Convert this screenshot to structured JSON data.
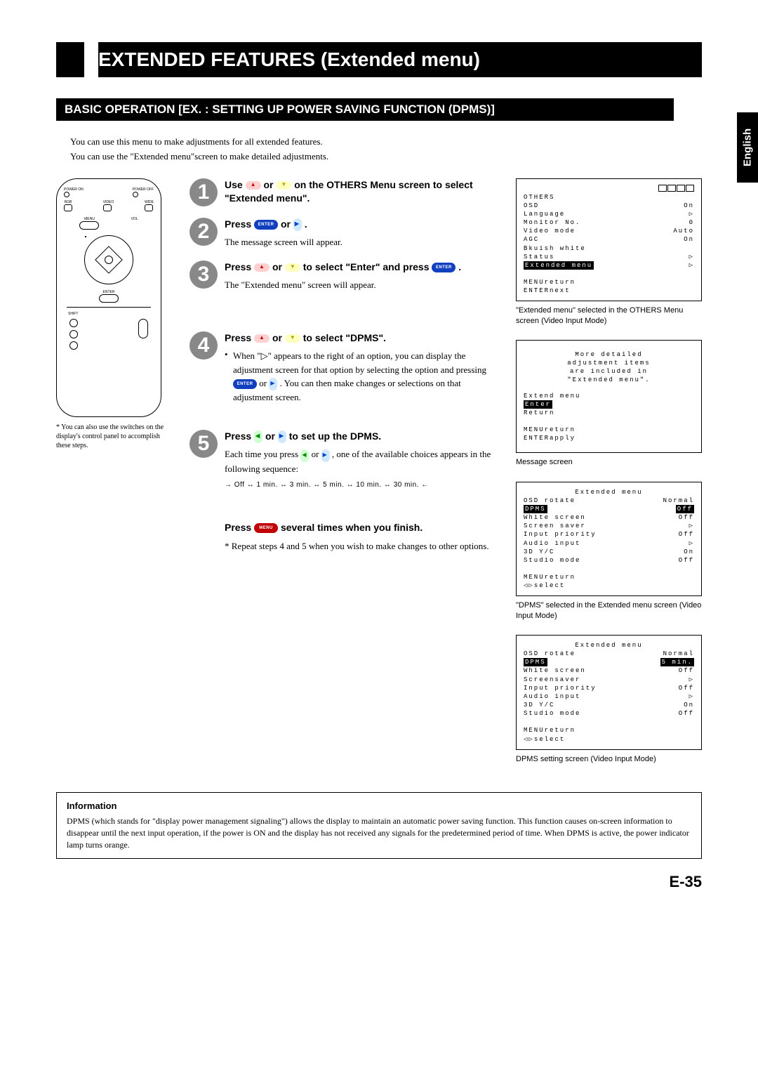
{
  "title": "EXTENDED FEATURES (Extended menu)",
  "subtitle": "BASIC OPERATION [EX. : SETTING UP POWER SAVING FUNCTION (DPMS)]",
  "side_tab": "English",
  "intro_line1": "You can use this menu to make adjustments for all extended features.",
  "intro_line2": "You can use the \"Extended menu\"screen to make detailed adjustments.",
  "remote": {
    "power_on": "POWER ON",
    "power_off": "POWER OFF",
    "rgb": "RGB",
    "video": "VIDEO",
    "wide": "WIDE",
    "menu": "MENU",
    "vol": "VOL",
    "enter": "ENTER",
    "shift": "SHIFT",
    "note": "* You can also use the switches on the display's control panel to accomplish these steps."
  },
  "steps": {
    "s1": {
      "num": "1",
      "t1": "Use ",
      "t2": " or ",
      "t3": " on the OTHERS Menu screen to select \"Extended menu\"."
    },
    "s2": {
      "num": "2",
      "t1": "Press ",
      "t2": " or ",
      "t3": ".",
      "note": "The message screen will appear."
    },
    "s3": {
      "num": "3",
      "t1": "Press ",
      "t2": " or ",
      "t3": " to select \"Enter\" and press ",
      "t4": ".",
      "note": "The \"Extended menu\" screen will appear."
    },
    "s4": {
      "num": "4",
      "t1": "Press ",
      "t2": " or ",
      "t3": " to select \"DPMS\".",
      "b1": "When \"▷\" appears to the right of an option, you can display the adjustment screen for that option by selecting the option and pressing ",
      "b2": " or ",
      "b3": ". You can then make changes or selections on that adjustment screen."
    },
    "s5": {
      "num": "5",
      "t1": "Press ",
      "t2": " or ",
      "t3": " to set up the DPMS.",
      "note1": "Each time you press ",
      "note2": " or ",
      "note3": ", one of the available choices appears in the following sequence:",
      "seq": "→ Off ↔ 1 min. ↔ 3 min. ↔ 5 min. ↔ 10 min. ↔ 30 min. ←"
    },
    "finish": {
      "t1": "Press ",
      "t2": " several times when you finish.",
      "note": "* Repeat steps 4 and 5 when you wish to make changes to other options."
    }
  },
  "buttons": {
    "enter": "ENTER",
    "menu": "MENU"
  },
  "osd1": {
    "l0a": "OTHERS",
    "l1a": "OSD",
    "l1b": "On",
    "l2a": "Language",
    "l2b": "▷",
    "l3a": "Monitor No.",
    "l3b": "0",
    "l4a": "Video mode",
    "l4b": "Auto",
    "l5a": "AGC",
    "l5b": "On",
    "l6a": "Bkuish white",
    "l6b": "",
    "l7a": "Status",
    "l7b": "▷",
    "l8a": "Extended menu",
    "l8b": "▷",
    "l9": "MENUreturn",
    "l10": "ENTERnext",
    "caption": "\"Extended menu\" selected in the OTHERS Menu screen (Video Input Mode)"
  },
  "osd2": {
    "l1": "More detailed",
    "l2": "adjustment items",
    "l3": "are included in",
    "l4": "\"Extended menu\".",
    "l5": "Extend menu",
    "l6": "Enter",
    "l7": "Return",
    "l8": "MENUreturn",
    "l9": "ENTERapply",
    "caption": "Message screen"
  },
  "osd3": {
    "l0": "Extended menu",
    "l1a": "OSD rotate",
    "l1b": "Normal",
    "l2a": "DPMS",
    "l2b": "Off",
    "l3a": "White screen",
    "l3b": "Off",
    "l4a": "Screen saver",
    "l4b": "▷",
    "l5a": "Input priority",
    "l5b": "Off",
    "l6a": "Audio input",
    "l6b": "▷",
    "l7a": "3D Y/C",
    "l7b": "On",
    "l8a": "Studio mode",
    "l8b": "Off",
    "l9": "MENUreturn",
    "l10": "◁▷select",
    "caption": "\"DPMS\" selected in the Extended menu screen (Video Input Mode)"
  },
  "osd4": {
    "l0": "Extended menu",
    "l1a": "OSD rotate",
    "l1b": "Normal",
    "l2a": "DPMS",
    "l2b": "5 min.",
    "l3a": "White screen",
    "l3b": "Off",
    "l4a": "Screensaver",
    "l4b": "▷",
    "l5a": "Input priority",
    "l5b": "Off",
    "l6a": "Audio input",
    "l6b": "▷",
    "l7a": "3D Y/C",
    "l7b": "On",
    "l8a": "Studio mode",
    "l8b": "Off",
    "l9": "MENUreturn",
    "l10": "◁▷select",
    "caption": "DPMS setting screen (Video Input Mode)"
  },
  "info": {
    "title": "Information",
    "body": "DPMS (which stands for \"display power management signaling\") allows the display to maintain an automatic power saving function. This function causes on-screen information to disappear until the next input operation, if the power is ON and the display has not received any signals for the predetermined period of time. When DPMS is active, the power indicator lamp turns orange."
  },
  "page_num": "E-35"
}
